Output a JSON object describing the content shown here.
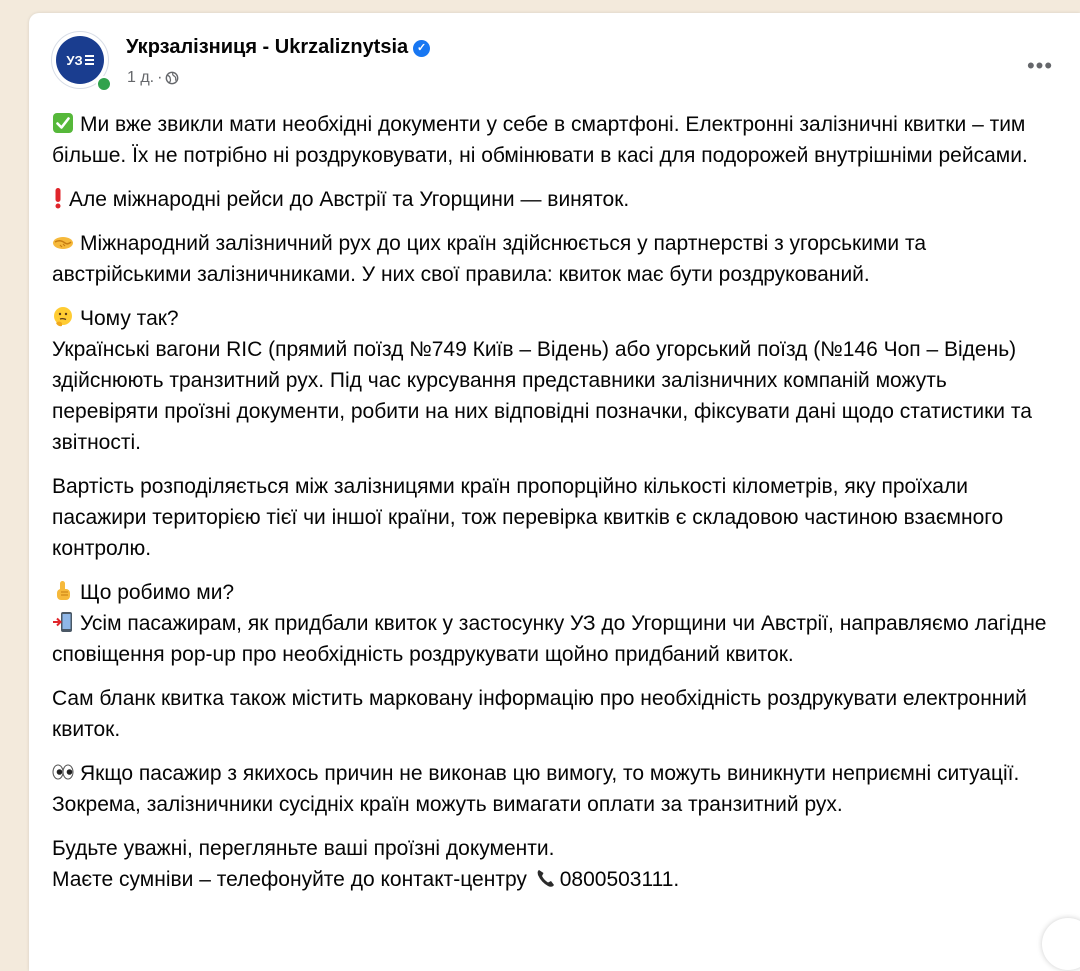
{
  "post": {
    "page_name": "Укрзалізниця - Ukrzaliznytsia",
    "avatar_text": "УЗ",
    "time": "1 д.",
    "separator": "·",
    "more_label": "•••",
    "paragraphs": {
      "p1": "Ми вже звикли мати необхідні документи у себе в смартфоні. Електронні залізничні квитки – тим більше. Їх не потрібно ні роздруковувати, ні обмінювати в касі для подорожей внутрішніми рейсами.",
      "p2": "Але міжнародні рейси до Австрії та Угорщини — виняток.",
      "p3": "Міжнародний залізничний рух до цих країн здійснюється у партнерстві з угорськими та австрійськими залізничниками. У них свої правила: квиток має бути роздрукований.",
      "p4_title": "Чому так?",
      "p4_text": "Українські вагони RIC (прямий поїзд №749 Київ – Відень) або угорський поїзд (№146 Чоп – Відень) здійснюють транзитний рух. Під час курсування представники залізничних компаній можуть перевіряти проїзні документи, робити на них відповідні позначки, фіксувати дані щодо статистики та звітності.",
      "p5": "Вартість розподіляється між залізницями країн пропорційно кількості кілометрів, яку проїхали пасажири територією тієї чи іншої країни, тож перевірка квитків є складовою частиною взаємного контролю.",
      "p6_title": "Що робимо ми?",
      "p6_text": "Усім пасажирам, як придбали квиток у застосунку УЗ до Угорщини чи Австрії, направляємо лагідне сповіщення pop-up про необхідність роздрукувати щойно придбаний квиток.",
      "p7": "Сам бланк квитка також містить марковану інформацію про необхідність роздрукувати електронний квиток.",
      "p8": "Якщо пасажир з якихось причин не виконав цю вимогу, то можуть виникнути неприємні ситуації. Зокрема, залізничники сусідніх країн можуть вимагати оплати за транзитний рух.",
      "p9_line1": "Будьте уважні, перегляньте ваші проїзні документи.",
      "p9_line2": "Маєте сумніви – телефонуйте до контакт-центру",
      "phone": "0800503111."
    }
  },
  "icons": {
    "p1": "check-mark-button-icon",
    "p2": "exclamation-icon",
    "p3": "handshake-icon",
    "p4": "thinking-face-icon",
    "p6": "pointing-up-icon",
    "p6b": "mobile-arrow-icon",
    "p8": "eyes-icon",
    "p9": "telephone-icon",
    "verified": "verified-badge-icon",
    "globe": "globe-icon"
  },
  "colors": {
    "verified": "#1877f2",
    "brand_avatar": "#1a3d8f",
    "online": "#31a24c"
  }
}
